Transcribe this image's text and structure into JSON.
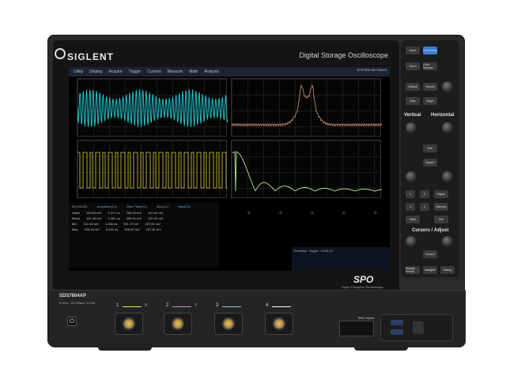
{
  "device": {
    "brand": "SIGLENT",
    "series_title": "Digital Storage Oscilloscope",
    "model": "SDS7804AP",
    "spec_line": "8 GHz / 20 GSa/s / 12-bit",
    "spo_logo": "SPO",
    "spo_tagline": "Super Phosphor Oscilloscope",
    "bnc_inputs_label": "BNC Inputs"
  },
  "screen": {
    "menu": [
      "Utility",
      "Display",
      "Acquire",
      "Trigger",
      "Cursors",
      "Measure",
      "Math",
      "Analysis"
    ],
    "corner_text": "SYSTEM SETTINGS",
    "measurement_headers": [
      "MEASURE",
      "Amplitude(C1)",
      "Rise Time(C1)",
      "Max(C1)",
      "Max(C4)"
    ],
    "measurement_rows": [
      [
        "Value",
        "103.84 mV",
        "3.477 ns",
        "255.92 mV",
        "157.81 mV"
      ],
      [
        "Mean",
        "101.36 mV",
        "3.481 ns",
        "255.91 mV",
        "157.81 mV"
      ],
      [
        "Min",
        "101.30 mV",
        "1.286 ns",
        "251.17 mV",
        "157.81 mV"
      ],
      [
        "Max",
        "105.18 mV",
        "5.431 ns",
        "256.32 mV",
        "157.81 mV"
      ]
    ],
    "info_box": [
      "Timebase",
      "Trigger",
      "14:08:32"
    ]
  },
  "panel": {
    "keys": [
      "Save",
      "Auto Setup",
      "Touch",
      "Clear Sweeps",
      "Default",
      "Normal",
      "Auto",
      "Single",
      "Roll",
      "Search",
      "Math",
      "Digital",
      "Memory",
      "Ref",
      "Cursors",
      "Display Persist",
      "Navigate",
      "History"
    ],
    "sections": [
      "Vertical",
      "Horizontal",
      "Cursors / Adjust"
    ],
    "channel_numbers": [
      "1",
      "2",
      "3",
      "4"
    ]
  },
  "channels": [
    {
      "num": "1",
      "name": "X",
      "color": "#e8e15a"
    },
    {
      "num": "2",
      "name": "Y",
      "color": "#d48adf"
    },
    {
      "num": "3",
      "name": "",
      "color": "#6fd3e8"
    },
    {
      "num": "4",
      "name": "",
      "color": "#ffffff"
    }
  ],
  "colors": {
    "ch1_trace": "#d9d23a",
    "ch2_trace": "#21c0c6",
    "fft_trace": "#d59a7b",
    "math_trace": "#b9e89a"
  }
}
